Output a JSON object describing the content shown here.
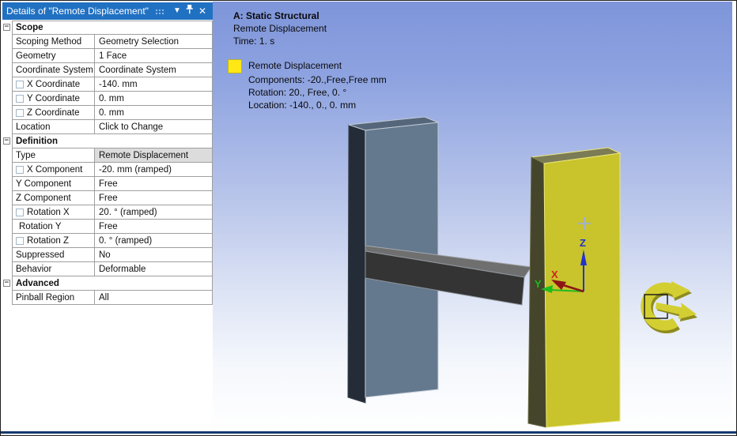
{
  "panel": {
    "header": {
      "title": "Details of \"Remote Displacement\"",
      "dropdown_icon": "▼",
      "close_icon": "✕"
    },
    "rows": [
      {
        "section": true,
        "label": "Scope"
      },
      {
        "label": "Scoping Method",
        "value": "Geometry Selection"
      },
      {
        "label": "Geometry",
        "value": "1 Face"
      },
      {
        "label": "Coordinate System",
        "value": "Coordinate System"
      },
      {
        "label": "X Coordinate",
        "value": "-140. mm",
        "checkbox": true
      },
      {
        "label": "Y Coordinate",
        "value": "0. mm",
        "checkbox": true
      },
      {
        "label": "Z Coordinate",
        "value": "0. mm",
        "checkbox": true
      },
      {
        "label": "Location",
        "value": "Click to Change"
      },
      {
        "section": true,
        "label": "Definition"
      },
      {
        "label": "Type",
        "value": "Remote Displacement",
        "selected": true
      },
      {
        "label": "X Component",
        "value": "-20. mm  (ramped)",
        "checkbox": true
      },
      {
        "label": "Y Component",
        "value": "Free"
      },
      {
        "label": "Z Component",
        "value": "Free"
      },
      {
        "label": "Rotation X",
        "value": "20. °  (ramped)",
        "checkbox": true
      },
      {
        "label": "Rotation Y",
        "value": "Free",
        "indent": true
      },
      {
        "label": "Rotation Z",
        "value": "0. °  (ramped)",
        "checkbox": true
      },
      {
        "label": "Suppressed",
        "value": "No"
      },
      {
        "label": "Behavior",
        "value": "Deformable"
      },
      {
        "section": true,
        "label": "Advanced"
      },
      {
        "label": "Pinball Region",
        "value": "All"
      }
    ]
  },
  "viewport": {
    "annotation": {
      "title": "A: Static Structural",
      "line2": "Remote Displacement",
      "line3": "Time: 1. s"
    },
    "legend": {
      "title": "Remote Displacement",
      "lines": [
        "Components: -20.,Free,Free mm",
        "Rotation: 20., Free, 0. °",
        "Location: -140., 0., 0. mm"
      ]
    },
    "triad": {
      "x": "X",
      "y": "Y",
      "z": "Z"
    }
  },
  "icons": {
    "collapse_minus": "−"
  },
  "colors": {
    "header_bg": "#2171c2",
    "viewport_top": "#7e95da",
    "viewport_bottom": "#ffffff",
    "legend_swatch": "#ffe815",
    "plate_side": "#242c38",
    "plate_top": "#55667b",
    "plate_front": "#64788e",
    "beam_top": "#6f6f6f",
    "beam_front": "#343434",
    "target_top": "#7b7b55",
    "target_side": "#45452c",
    "target_front": "#c9c32c",
    "rotation_symbol": "#d3cf33",
    "rotation_symbol_dark": "#8e8b1e",
    "axis_x": "#8c1616",
    "axis_y": "#1fbb1f",
    "axis_z": "#2233cc",
    "cross_marker": "#9aaee8"
  }
}
